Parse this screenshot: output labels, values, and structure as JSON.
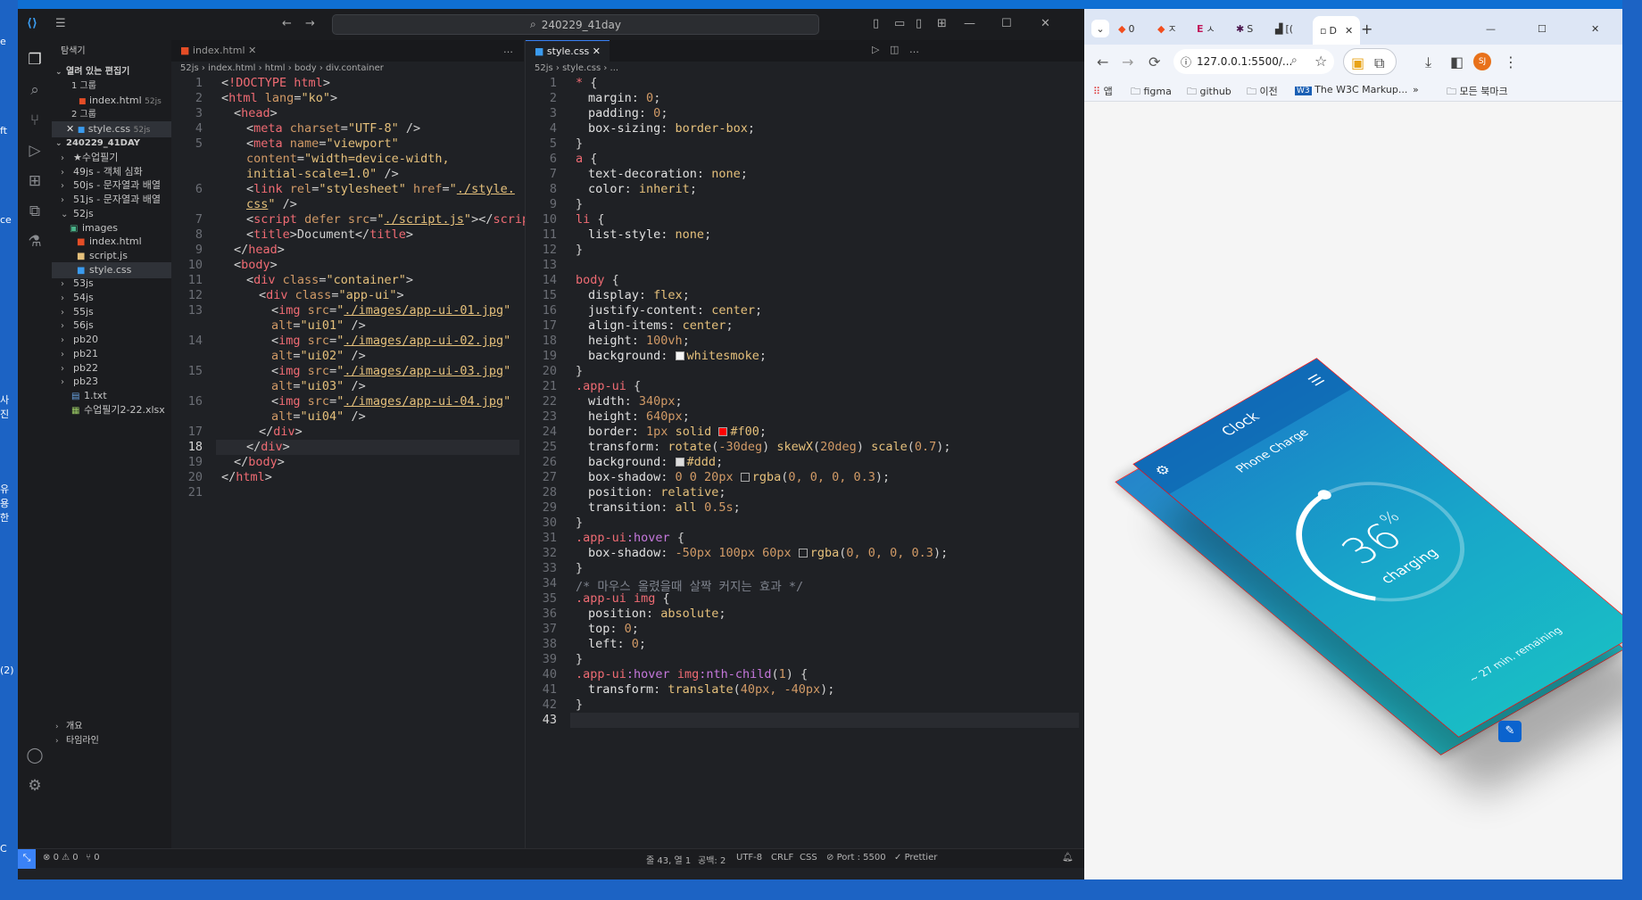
{
  "desktop": {
    "left_labels": [
      "e",
      "ft",
      "ce",
      "사진",
      "유용한",
      "(2)",
      "C"
    ]
  },
  "vscode": {
    "search_text": "240229_41day",
    "sidebar": {
      "title": "탐색기",
      "open_editors": "열려 있는 편집기",
      "group1": "1 그룹",
      "group1_file": "index.html",
      "group1_file_path": "52js",
      "group2": "2 그룹",
      "group2_file": "style.css",
      "group2_file_path": "52js",
      "project": "240229_41DAY",
      "tree": [
        {
          "label": "★수업필기",
          "type": "folder"
        },
        {
          "label": "49js - 객체 심화",
          "type": "folder"
        },
        {
          "label": "50js - 문자열과 배열",
          "type": "folder"
        },
        {
          "label": "51js - 문자열과 배열",
          "type": "folder"
        },
        {
          "label": "52js",
          "type": "open"
        },
        {
          "label": "images",
          "type": "sub-folder"
        },
        {
          "label": "index.html",
          "type": "sub-html"
        },
        {
          "label": "script.js",
          "type": "sub-js"
        },
        {
          "label": "style.css",
          "type": "sub-css"
        },
        {
          "label": "53js",
          "type": "folder"
        },
        {
          "label": "54js",
          "type": "folder"
        },
        {
          "label": "55js",
          "type": "folder"
        },
        {
          "label": "56js",
          "type": "folder"
        },
        {
          "label": "pb20",
          "type": "folder"
        },
        {
          "label": "pb21",
          "type": "folder"
        },
        {
          "label": "pb22",
          "type": "folder"
        },
        {
          "label": "pb23",
          "type": "folder"
        },
        {
          "label": "1.txt",
          "type": "file-txt"
        },
        {
          "label": "수업필기2-22.xlsx",
          "type": "file-xlsx"
        }
      ],
      "outline": "개요",
      "timeline": "타임라인"
    },
    "left_editor": {
      "tab": "index.html",
      "crumbs": [
        "52js",
        "index.html",
        "html",
        "body",
        "div.container"
      ]
    },
    "right_editor": {
      "tab": "style.css",
      "crumbs": [
        "52js",
        "style.css",
        "..."
      ]
    },
    "status": {
      "errors": "0",
      "warnings": "0",
      "ports": "0",
      "position": "줄 43, 열 1",
      "spaces": "공백: 2",
      "encoding": "UTF-8",
      "eol": "CRLF",
      "language": "CSS",
      "port": "Port : 5500",
      "prettier": "Prettier"
    }
  },
  "chrome": {
    "tabs": [
      "0",
      "ㅈ",
      "ㅅ",
      "S",
      "[(",
      "D"
    ],
    "address": "127.0.0.1:5500/...",
    "profile": "SJ",
    "bookmarks": [
      "앱",
      "figma",
      "github",
      "이전",
      "The W3C Markup...",
      "모든 북마크"
    ],
    "card": {
      "top_title": "Clock",
      "subtitle": "Phone Charge",
      "percent": "36",
      "percent_sign": "%",
      "status": "charging",
      "remaining": "~ 27 min. remaining"
    }
  },
  "colors": {
    "vscode_bg": "#1f2125",
    "accent": "#3a82f7",
    "card_top": "#1a80c8",
    "card_bottom": "#19bcc5"
  }
}
